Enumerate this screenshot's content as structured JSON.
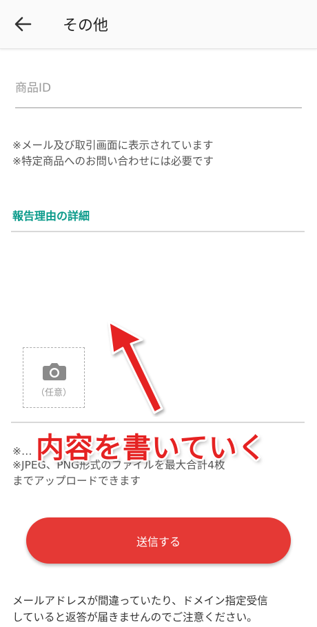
{
  "header": {
    "title": "その他",
    "back_icon": "arrow-left-icon"
  },
  "form": {
    "product_id_placeholder": "商品ID",
    "product_id_value": "",
    "notes": [
      "※メール及び取引画面に表示されています",
      "※特定商品へのお問い合わせには必要です"
    ],
    "section_title": "報告理由の詳細",
    "details_value": "",
    "photo": {
      "icon": "camera-icon",
      "label": "（任意）"
    },
    "upload_notes": [
      "※…",
      "※JPEG、PNG形式のファイルを最大合計4枚",
      "までアップロードできます"
    ],
    "submit_label": "送信する"
  },
  "annotation": {
    "text": "内容を書いていく",
    "color": "#e52222",
    "arrow_icon": "red-arrow-up-icon"
  },
  "footer": {
    "lines": [
      "メールアドレスが間違っていたり、ドメイン指定受信",
      "していると返答が届きませんのでご注意ください。"
    ]
  },
  "colors": {
    "accent": "#0a9a8a",
    "submit": "#e53935"
  }
}
